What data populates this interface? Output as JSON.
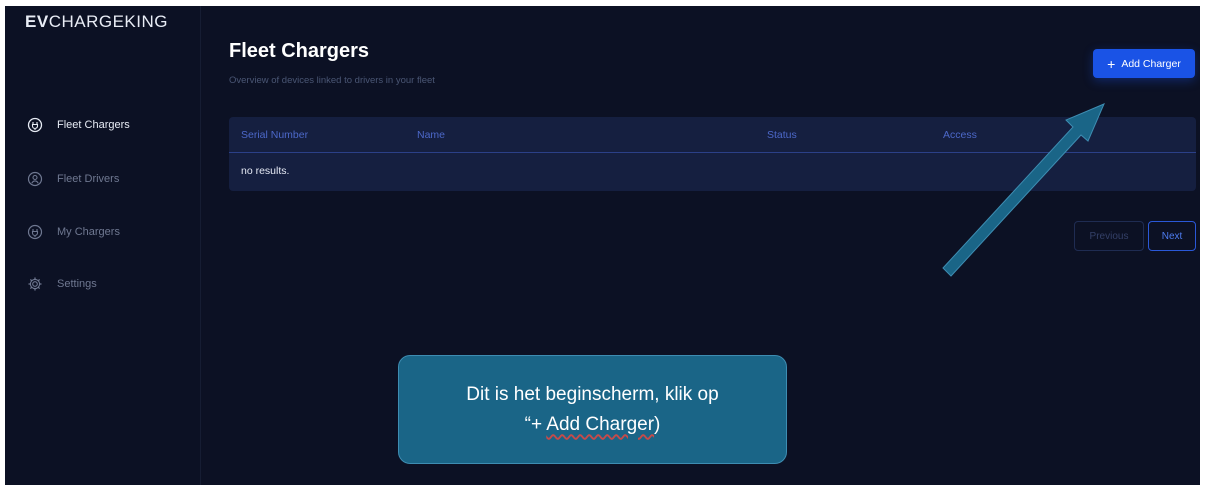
{
  "brand": {
    "prefix": "EV",
    "name": "CHARGEKING"
  },
  "sidebar": {
    "items": [
      {
        "label": "Fleet Chargers",
        "icon": "plug-icon",
        "active": true
      },
      {
        "label": "Fleet Drivers",
        "icon": "user-icon",
        "active": false
      },
      {
        "label": "My Chargers",
        "icon": "plug-icon",
        "active": false
      },
      {
        "label": "Settings",
        "icon": "gear-icon",
        "active": false
      }
    ]
  },
  "header": {
    "title": "Fleet Chargers",
    "subtitle": "Overview of devices linked to drivers in your fleet",
    "add_button": {
      "icon": "+",
      "label": "Add Charger"
    }
  },
  "table": {
    "columns": [
      "Serial Number",
      "Name",
      "Status",
      "Access"
    ],
    "empty_text": "no results."
  },
  "pagination": {
    "previous": "Previous",
    "next": "Next"
  },
  "callout": {
    "line1": "Dit is het beginscherm, klik op",
    "line2_prefix": "“+ ",
    "line2_link": "Add Charger",
    "line2_suffix": ")"
  },
  "colors": {
    "background": "#0c1124",
    "accent": "#1a53e6",
    "table_bg": "#151f40",
    "callout_bg": "#1a6587"
  }
}
